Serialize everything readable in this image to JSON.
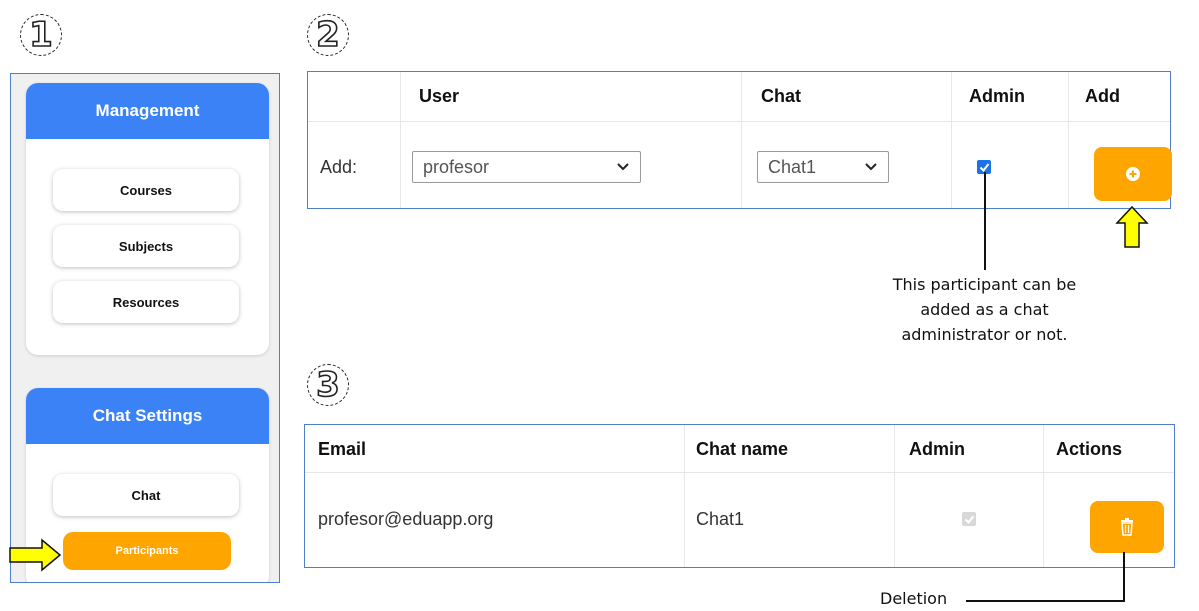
{
  "steps": [
    "1",
    "2",
    "3"
  ],
  "sidebar": {
    "management": {
      "title": "Management",
      "items": [
        "Courses",
        "Subjects",
        "Resources"
      ]
    },
    "chat_settings": {
      "title": "Chat Settings",
      "items": [
        "Chat",
        "Participants"
      ]
    }
  },
  "add_form": {
    "headers": [
      "User",
      "Chat",
      "Admin",
      "Add"
    ],
    "row_label": "Add:",
    "user_value": "profesor",
    "chat_value": "Chat1",
    "admin_checked": true
  },
  "annotation_admin": "This participant can be added as a chat administrator or not.",
  "participants_table": {
    "headers": [
      "Email",
      "Chat name",
      "Admin",
      "Actions"
    ],
    "rows": [
      {
        "email": "profesor@eduapp.org",
        "chat_name": "Chat1",
        "admin": true
      }
    ]
  },
  "annotation_delete": "Deletion",
  "colors": {
    "accent": "#ffa500",
    "header_blue": "#3b82f6",
    "border_blue": "#4f7fc9",
    "arrow_yellow": "#ffff00"
  },
  "icons": [
    "plus-circle-icon",
    "trash-icon",
    "chevron-down-icon",
    "pointer-arrow-icon"
  ]
}
